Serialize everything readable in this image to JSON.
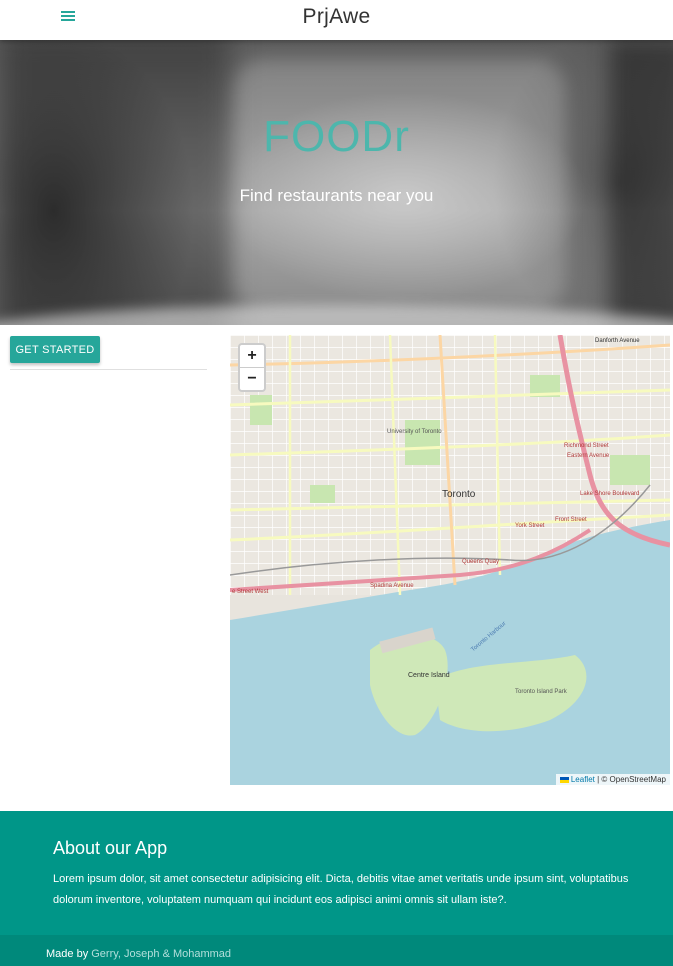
{
  "nav": {
    "brand": "PrjAwe",
    "menu_icon": "menu-icon"
  },
  "hero": {
    "title": "FOODr",
    "subtitle": "Find restaurants near you"
  },
  "sidebar": {
    "get_started_label": "GET STARTED"
  },
  "map": {
    "zoom_in": "+",
    "zoom_out": "−",
    "labels": {
      "toronto": "Toronto",
      "university": "University of Toronto",
      "centre_island": "Centre Island",
      "toronto_island_park": "Toronto Island Park",
      "richmond": "Richmond Street",
      "eastern": "Eastern Avenue",
      "lake_shore": "Lake Shore Boulevard",
      "danforth": "Danforth Avenue",
      "york": "York Street",
      "front": "Front Street",
      "spadina": "Spadina Avenue",
      "queens_quay": "Queens Quay",
      "harbour": "Toronto Harbour",
      "west_street": "e Street West"
    },
    "attribution_leaflet": "Leaflet",
    "attribution_rest": " | © OpenStreetMap"
  },
  "footer": {
    "about_title": "About our App",
    "about_text": "Lorem ipsum dolor, sit amet consectetur adipisicing elit. Dicta, debitis vitae amet veritatis unde ipsum sint, voluptatibus dolorum inventore, voluptatem numquam qui incidunt eos adipisci animi omnis sit ullam iste?.",
    "made_by": "Made by ",
    "authors": "Gerry, Joseph & Mohammad"
  },
  "colors": {
    "teal": "#26a69a",
    "footer": "#009688",
    "copyright": "#00897b",
    "title": "#4db6ac"
  }
}
